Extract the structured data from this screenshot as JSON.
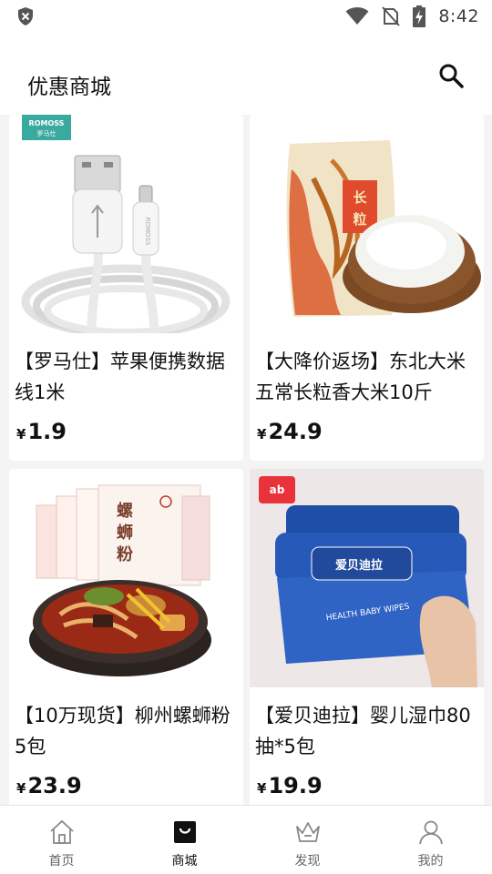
{
  "status_bar": {
    "time": "8:42",
    "icons": [
      "shield-icon",
      "wifi-icon",
      "no-sim-icon",
      "battery-charging-icon"
    ]
  },
  "header": {
    "title": "优惠商城",
    "search_icon": "search-icon"
  },
  "products": [
    {
      "name": "【罗马仕】苹果便携数据线1米",
      "currency": "¥",
      "price": "1.9",
      "brand_tag": "ROMOSS 罗马仕",
      "image": "usb-lightning-cable"
    },
    {
      "name": "【大降价返场】东北大米五常长粒香大米10斤",
      "currency": "¥",
      "price": "24.9",
      "package_text": "长粒",
      "image": "rice-bag-and-bowl"
    },
    {
      "name": "【10万现货】柳州螺蛳粉5包",
      "currency": "¥",
      "price": "23.9",
      "package_text": "螺蛳粉",
      "image": "river-snail-noodles"
    },
    {
      "name": "【爱贝迪拉】婴儿湿巾80抽*5包",
      "currency": "¥",
      "price": "19.9",
      "package_text": "HEALTH BABY WIPES",
      "image": "baby-wipes"
    }
  ],
  "bottom_nav": [
    {
      "label": "首页",
      "icon": "home-icon",
      "active": false
    },
    {
      "label": "商城",
      "icon": "shopping-bag-icon",
      "active": true
    },
    {
      "label": "发现",
      "icon": "crown-icon",
      "active": false
    },
    {
      "label": "我的",
      "icon": "user-icon",
      "active": false
    }
  ],
  "colors": {
    "background": "#f4f4f4",
    "card": "#ffffff",
    "text": "#111111",
    "nav_inactive": "#666666"
  }
}
